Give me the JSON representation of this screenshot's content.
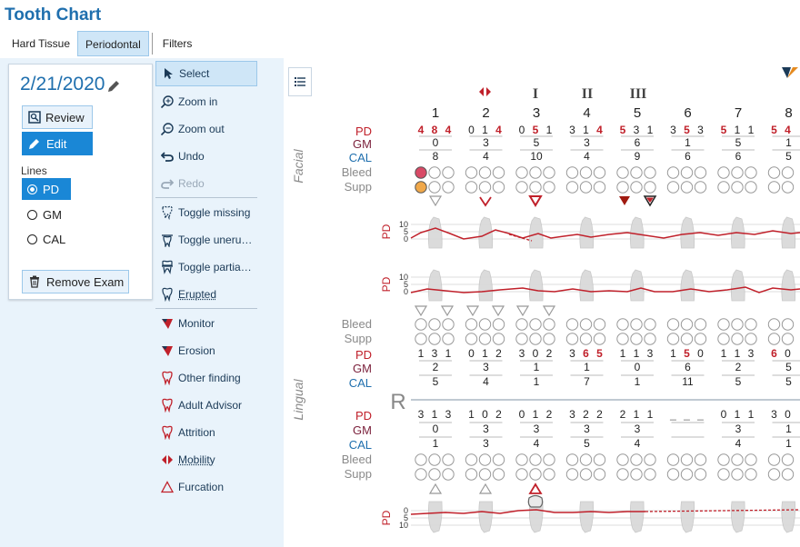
{
  "app": {
    "title": "Tooth Chart"
  },
  "tabs": [
    "Hard Tissue",
    "Periodontal",
    "Filters"
  ],
  "exam": {
    "date": "2/21/2020",
    "review_label": "Review",
    "edit_label": "Edit",
    "lines_label": "Lines",
    "lines": [
      "PD",
      "GM",
      "CAL"
    ],
    "selected_line": "PD",
    "remove_label": "Remove Exam"
  },
  "tools": {
    "select": "Select",
    "zoom_in": "Zoom in",
    "zoom_out": "Zoom out",
    "undo": "Undo",
    "redo": "Redo",
    "toggle_missing": "Toggle missing",
    "toggle_unerupted": "Toggle uneru…",
    "toggle_partial": "Toggle partia…",
    "erupted": "Erupted",
    "monitor": "Monitor",
    "erosion": "Erosion",
    "other_finding": "Other finding",
    "adult_advisor": "Adult Advisor",
    "attrition": "Attrition",
    "mobility": "Mobility",
    "furcation": "Furcation"
  },
  "chart": {
    "teeth": [
      "1",
      "2",
      "3",
      "4",
      "5",
      "6",
      "7",
      "8"
    ],
    "mobility_marks": [
      "I",
      "II",
      "III"
    ],
    "row_labels": {
      "pd": "PD",
      "gm": "GM",
      "cal": "CAL",
      "bleed": "Bleed",
      "supp": "Supp"
    },
    "facial_label": "Facial",
    "lingual_label": "Lingual",
    "quadrant": "R",
    "graph_axis_label": "PD",
    "graph_ticks": [
      "10",
      "5",
      "0"
    ],
    "graph_ticks_lower": [
      "0",
      "5",
      "10"
    ],
    "upper_facial": {
      "pd": [
        [
          "4",
          "8",
          "4"
        ],
        [
          "0",
          "1",
          "4"
        ],
        [
          "0",
          "5",
          "1"
        ],
        [
          "3",
          "1",
          "4"
        ],
        [
          "5",
          "3",
          "1"
        ],
        [
          "3",
          "5",
          "3"
        ],
        [
          "5",
          "1",
          "1"
        ],
        [
          "5",
          "4",
          ""
        ]
      ],
      "gm": [
        "0",
        "3",
        "5",
        "3",
        "6",
        "1",
        "5",
        "1"
      ],
      "cal": [
        "8",
        "4",
        "10",
        "4",
        "9",
        "6",
        "6",
        "5"
      ]
    },
    "upper_lingual": {
      "pd": [
        [
          "1",
          "3",
          "1"
        ],
        [
          "0",
          "1",
          "2"
        ],
        [
          "3",
          "0",
          "2"
        ],
        [
          "3",
          "6",
          "5"
        ],
        [
          "1",
          "1",
          "3"
        ],
        [
          "1",
          "5",
          "0"
        ],
        [
          "1",
          "1",
          "3"
        ],
        [
          "6",
          "0",
          ""
        ]
      ],
      "gm": [
        "2",
        "3",
        "1",
        "1",
        "0",
        "6",
        "2",
        "5"
      ],
      "cal": [
        "5",
        "4",
        "1",
        "7",
        "1",
        "11",
        "5",
        "5"
      ]
    },
    "lower_lingual": {
      "pd": [
        [
          "3",
          "1",
          "3"
        ],
        [
          "1",
          "0",
          "2"
        ],
        [
          "0",
          "1",
          "2"
        ],
        [
          "3",
          "2",
          "2"
        ],
        [
          "2",
          "1",
          "1"
        ],
        [
          "_",
          "_",
          "_"
        ],
        [
          "0",
          "1",
          "1"
        ],
        [
          "3",
          "0",
          ""
        ]
      ],
      "gm": [
        "0",
        "3",
        "3",
        "3",
        "3",
        "",
        "3",
        "1"
      ],
      "cal": [
        "1",
        "3",
        "4",
        "5",
        "4",
        "",
        "4",
        "1"
      ]
    },
    "colors": {
      "red": "#c0202a",
      "blue": "#1f6fae",
      "maroon": "#7a1f3a",
      "gray": "#8a8a8a"
    }
  }
}
